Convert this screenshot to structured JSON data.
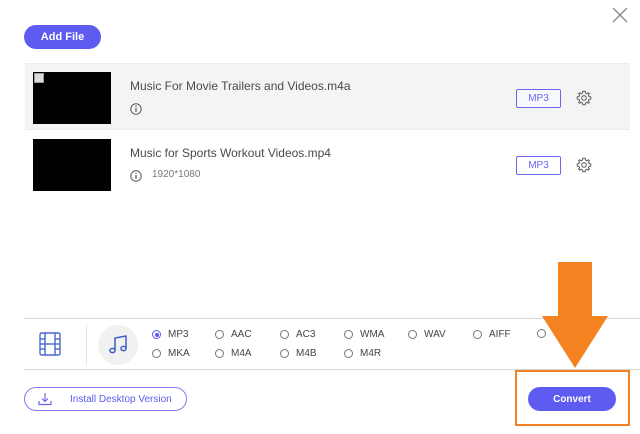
{
  "toolbar": {
    "add_file_label": "Add File"
  },
  "files": [
    {
      "name": "Music For Movie Trailers and Videos.m4a",
      "resolution": "",
      "format": "MP3"
    },
    {
      "name": "Music for Sports Workout Videos.mp4",
      "resolution": "1920*1080",
      "format": "MP3"
    }
  ],
  "formats": {
    "selected": "MP3",
    "row1": [
      "MP3",
      "AAC",
      "AC3",
      "WMA",
      "WAV",
      "AIFF"
    ],
    "row2": [
      "MKA",
      "M4A",
      "M4B",
      "M4R"
    ]
  },
  "footer": {
    "install_label": "Install Desktop Version",
    "convert_label": "Convert"
  },
  "colors": {
    "accent": "#5e5bf0",
    "annotation": "#f08124"
  },
  "icons": {
    "close": "close-icon",
    "info": "info-icon",
    "settings": "gear-icon",
    "video_tab": "film-icon",
    "audio_tab": "music-note-icon",
    "download": "download-icon"
  }
}
